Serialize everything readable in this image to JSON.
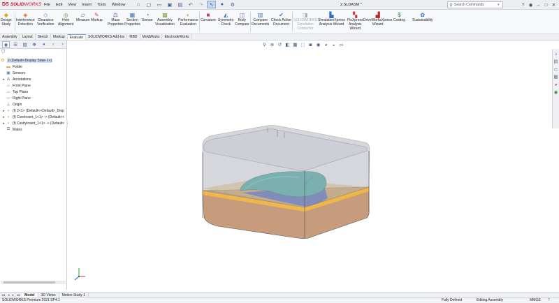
{
  "app": {
    "brand_ds": "DS",
    "brand_solid": "SOLID",
    "brand_works": "WORKS",
    "doc_title": "2.SLDASM *"
  },
  "menu": [
    "File",
    "Edit",
    "View",
    "Insert",
    "Tools",
    "Window"
  ],
  "quick_icons": [
    "home-icon",
    "new-document-icon",
    "open-icon",
    "save-icon",
    "print-icon",
    "undo-icon",
    "redo-icon",
    "select-icon",
    "rebuild-icon",
    "options-icon"
  ],
  "search": {
    "placeholder": "Search Commands"
  },
  "command_groups": [
    {
      "label": "Design\nStudy",
      "icon": "design-study-icon"
    },
    {
      "label": "Interference\nDetection",
      "icon": "interference-icon"
    },
    {
      "label": "Clearance\nVerification",
      "icon": "clearance-icon"
    },
    {
      "label": "Hole\nAlignment",
      "icon": "hole-alignment-icon"
    },
    {
      "label": "Measure",
      "icon": "measure-icon"
    },
    {
      "label": "Markup",
      "icon": "markup-icon"
    },
    {
      "label": "Mass\nProperties",
      "icon": "mass-properties-icon"
    },
    {
      "label": "Section\nProperties",
      "icon": "section-properties-icon"
    },
    {
      "label": "Sensor",
      "icon": "sensor-icon"
    },
    {
      "label": "Assembly\nVisualization",
      "icon": "assembly-visualization-icon"
    },
    {
      "label": "Performance\nEvaluation",
      "icon": "performance-icon"
    },
    {
      "label": "Curvature",
      "icon": "curvature-icon"
    },
    {
      "label": "Symmetry\nCheck",
      "icon": "symmetry-icon"
    },
    {
      "label": "Body\nCompare",
      "icon": "body-compare-icon"
    },
    {
      "label": "Compare\nDocuments",
      "icon": "compare-documents-icon"
    },
    {
      "label": "Check Active\nDocument",
      "icon": "check-document-icon"
    },
    {
      "label": "SOLIDWORKS\nSimulation\nConnector",
      "icon": "simulation-connector-icon"
    },
    {
      "label": "SimulationXpress\nAnalysis Wizard",
      "icon": "simulationxpress-icon"
    },
    {
      "label": "FloXpress\nAnalysis\nWizard",
      "icon": "floxpress-icon"
    },
    {
      "label": "DriveWorksXpress\nWizard",
      "icon": "driveworks-icon"
    },
    {
      "label": "Costing",
      "icon": "costing-icon"
    },
    {
      "label": "Sustainability",
      "icon": "sustainability-icon"
    }
  ],
  "tabs": [
    "Assembly",
    "Layout",
    "Sketch",
    "Markup",
    "Evaluate",
    "SOLIDWORKS Add-Ins",
    "MBD",
    "MoldWorks",
    "ElectrodeWorks"
  ],
  "active_tab": "Evaluate",
  "tree": {
    "root": "2  (Default<Display State-1>)",
    "items": [
      {
        "label": "Folder",
        "icon": "folder-icon",
        "twisty": ""
      },
      {
        "label": "Sensors",
        "icon": "sensor-icon",
        "twisty": ""
      },
      {
        "label": "Annotations",
        "icon": "annotations-icon",
        "twisty": "▸"
      },
      {
        "label": "Front Plane",
        "icon": "plane-icon",
        "twisty": ""
      },
      {
        "label": "Top Plane",
        "icon": "plane-icon",
        "twisty": ""
      },
      {
        "label": "Right Plane",
        "icon": "plane-icon",
        "twisty": ""
      },
      {
        "label": "Origin",
        "icon": "origin-icon",
        "twisty": ""
      },
      {
        "label": "(f) 2<1> (Default<<Default>_Disp",
        "icon": "part-icon",
        "twisty": "▸"
      },
      {
        "label": "(f) CoreInsert_1<1> -> (Default<<",
        "icon": "part-icon",
        "twisty": "▸"
      },
      {
        "label": "(f) CavityInsert_1<1> -> (Default<",
        "icon": "part-icon",
        "twisty": "▸"
      },
      {
        "label": "Mates",
        "icon": "mates-icon",
        "twisty": ""
      }
    ]
  },
  "bottom_tabs": [
    "Model",
    "3D Views",
    "Motion Study 1"
  ],
  "status": {
    "product": "SOLIDWORKS Premium 2021 SP4.1",
    "defined": "Fully Defined",
    "mode": "Editing Assembly",
    "units": "MMGS"
  }
}
